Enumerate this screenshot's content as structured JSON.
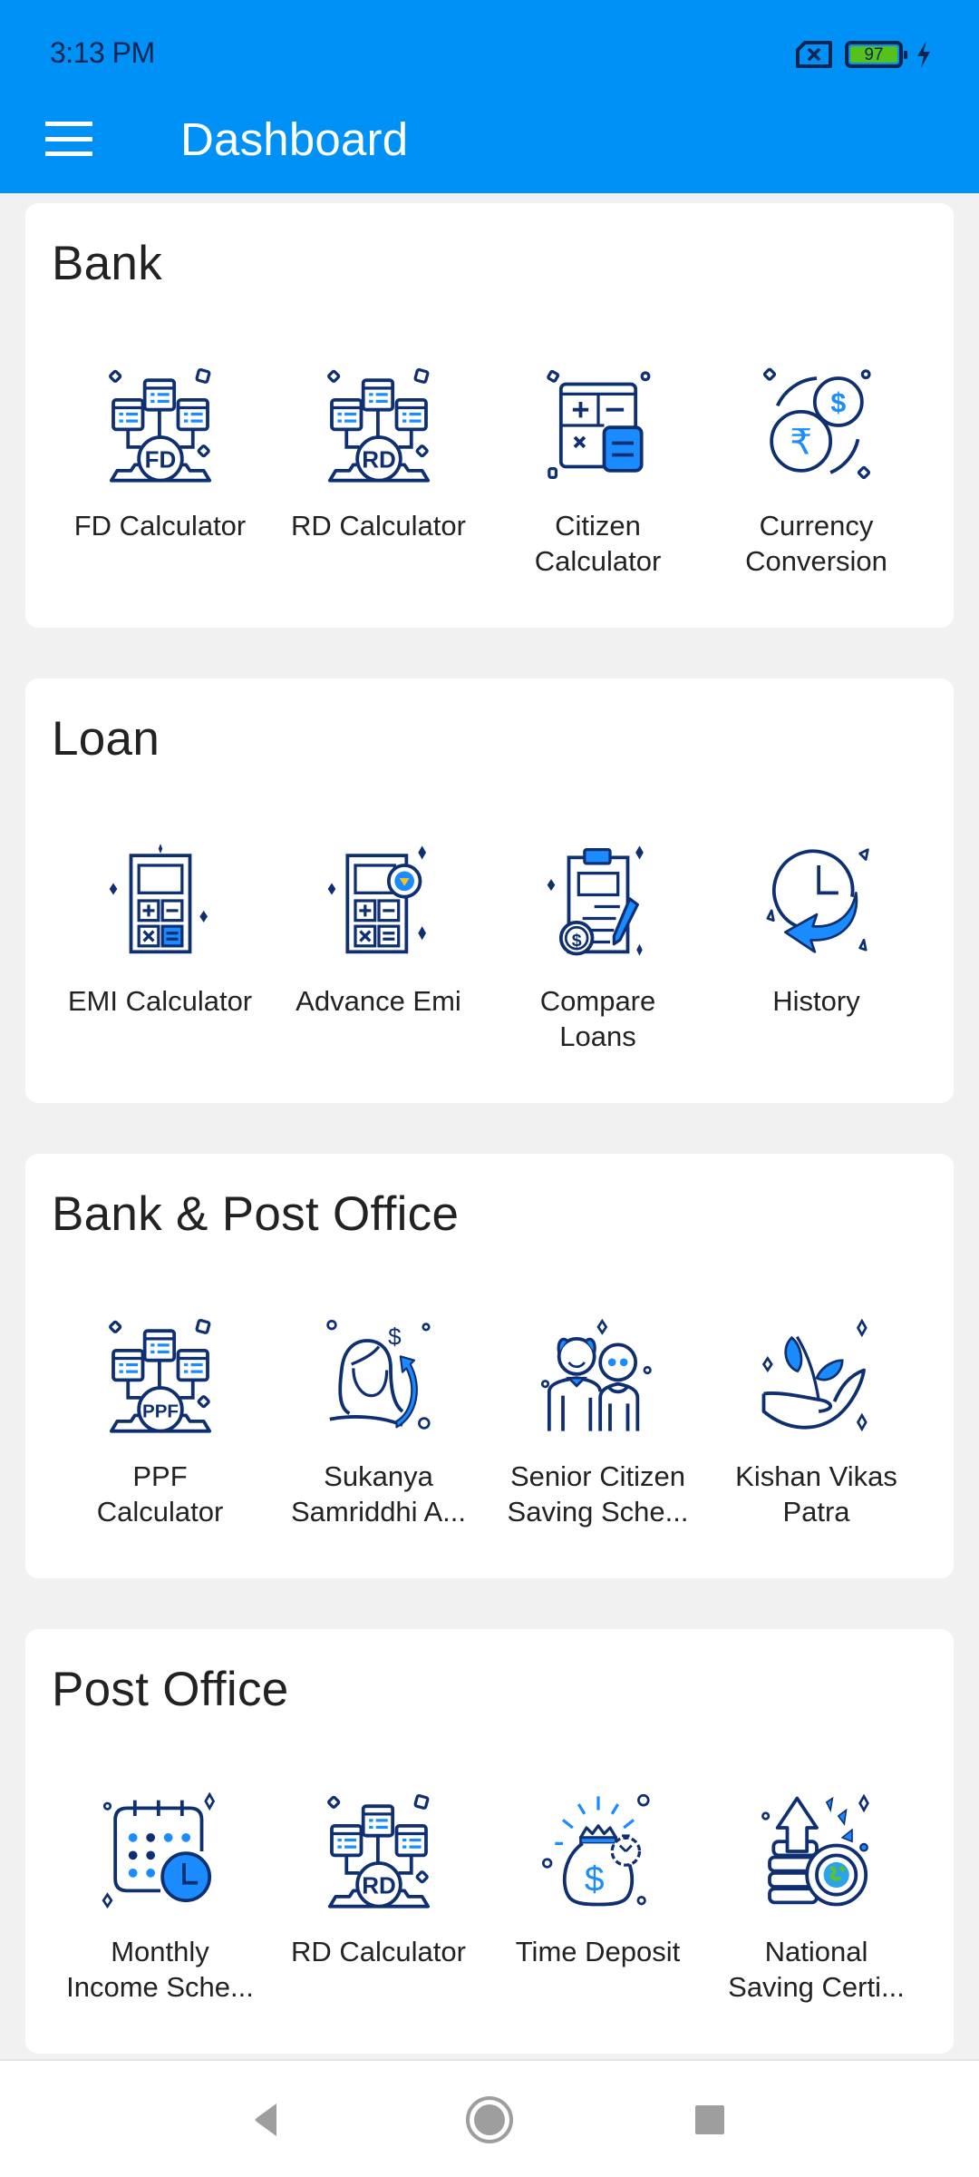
{
  "status_bar": {
    "time": "3:13 PM",
    "battery_level": "97",
    "icons": [
      "no-sim-icon",
      "battery-icon",
      "charging-bolt-icon"
    ]
  },
  "app_bar": {
    "title": "Dashboard",
    "menu_icon": "hamburger-menu-icon"
  },
  "colors": {
    "app_bar": "#0091f7",
    "background": "#f1f1f1",
    "icon_navy": "#0f2f73",
    "icon_blue": "#1a8cff",
    "battery_fill": "#55c21b"
  },
  "sections": [
    {
      "title": "Bank",
      "items": [
        {
          "label": "FD Calculator",
          "icon": "fd-network-icon"
        },
        {
          "label": "RD Calculator",
          "icon": "rd-network-icon"
        },
        {
          "label": "Citizen\nCalculator",
          "icon": "calculator-grid-icon"
        },
        {
          "label": "Currency\nConversion",
          "icon": "currency-coins-icon"
        }
      ]
    },
    {
      "title": "Loan",
      "items": [
        {
          "label": "EMI Calculator",
          "icon": "emi-calculator-icon"
        },
        {
          "label": "Advance Emi",
          "icon": "advance-calculator-icon"
        },
        {
          "label": "Compare\nLoans",
          "icon": "clipboard-compare-icon"
        },
        {
          "label": "History",
          "icon": "history-clock-icon"
        }
      ]
    },
    {
      "title": "Bank & Post Office",
      "items": [
        {
          "label": "PPF\nCalculator",
          "icon": "ppf-network-icon"
        },
        {
          "label": "Sukanya\nSamriddhi A...",
          "icon": "girl-growth-icon"
        },
        {
          "label": "Senior Citizen\nSaving Sche...",
          "icon": "senior-couple-icon"
        },
        {
          "label": "Kishan Vikas\nPatra",
          "icon": "plant-hand-icon"
        }
      ]
    },
    {
      "title": "Post Office",
      "items": [
        {
          "label": "Monthly\nIncome Sche...",
          "icon": "calendar-clock-icon"
        },
        {
          "label": "RD Calculator",
          "icon": "rd-network-icon"
        },
        {
          "label": "Time Deposit",
          "icon": "money-bag-timer-icon"
        },
        {
          "label": "National\nSaving Certi...",
          "icon": "coins-globe-icon"
        }
      ]
    }
  ],
  "nav_bar": {
    "buttons": [
      "back-icon",
      "home-icon",
      "recents-icon"
    ]
  }
}
